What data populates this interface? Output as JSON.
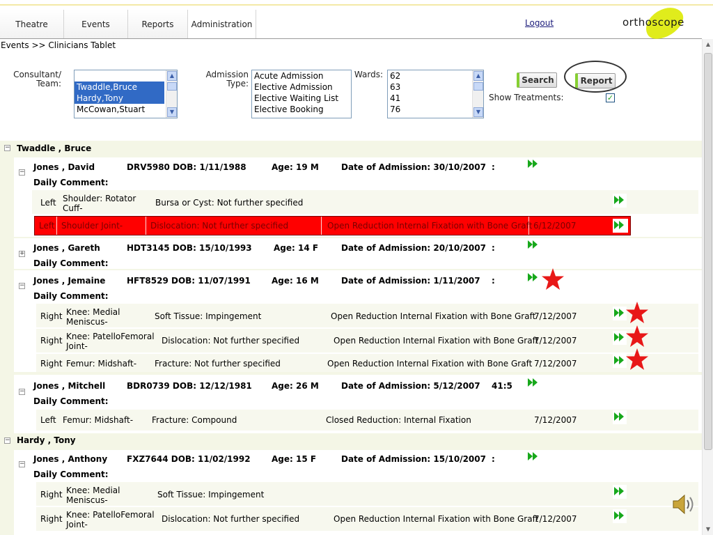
{
  "nav": {
    "tabs": [
      "Theatre",
      "Events",
      "Reports",
      "Administration"
    ],
    "logout": "Logout",
    "logo": "orthoscope"
  },
  "breadcrumb": "Events >> Clinicians Tablet",
  "filters": {
    "consultant_label_1": "Consultant/",
    "consultant_label_2": "Team:",
    "consultant_options": [
      "",
      "Twaddle,Bruce",
      "Hardy,Tony",
      "McCowan,Stuart"
    ],
    "admission_label_1": "Admission",
    "admission_label_2": "Type:",
    "admission_options": [
      "Acute Admission",
      "Elective Admission",
      "Elective Waiting List",
      "Elective Booking"
    ],
    "wards_label": "Wards:",
    "ward_options": [
      "62",
      "63",
      "41",
      "76"
    ],
    "search_button": "Search",
    "report_button": "Report",
    "show_treatments_label": "Show Treatments:",
    "show_treatments_checked": true
  },
  "consultants": [
    {
      "name": "Twaddle , Bruce",
      "patients": [
        {
          "name": "Jones , David",
          "id_dob": "DRV5980 DOB: 1/11/1988",
          "age": "Age: 19 M",
          "admission": "Date of Admission: 30/10/2007",
          "bed": ":",
          "daily_comment": "Daily Comment:",
          "treatments": [
            {
              "side": "Left",
              "site": [
                "Shoulder: Rotator",
                "Cuff-"
              ],
              "diagnosis": "Bursa or Cyst: Not further specified",
              "procedure": "",
              "date": ""
            },
            {
              "side": "Left",
              "site": [
                "Shoulder Joint-"
              ],
              "diagnosis": "Dislocation: Not further specified",
              "procedure": "Open Reduction Internal Fixation with Bone Graft",
              "date": "6/12/2007",
              "highlighted": true
            }
          ]
        },
        {
          "name": "Jones , Gareth",
          "id_dob": "HDT3145 DOB: 15/10/1993",
          "age": "Age: 14 F",
          "admission": "Date of Admission: 20/10/2007",
          "bed": ":",
          "daily_comment": "Daily Comment:",
          "treatments": []
        },
        {
          "name": "Jones , Jemaine",
          "id_dob": "HFT8529 DOB: 11/07/1991",
          "age": "Age: 16 M",
          "admission": "Date of Admission: 1/11/2007",
          "bed": ":",
          "daily_comment": "Daily Comment:",
          "treatments": [
            {
              "side": "Right",
              "site": [
                "Knee: Medial",
                "Meniscus-"
              ],
              "diagnosis": "Soft Tissue: Impingement",
              "procedure": "Open Reduction Internal Fixation with Bone Graft",
              "date": "7/12/2007"
            },
            {
              "side": "Right",
              "site": [
                "Knee: PatelloFemoral",
                "Joint-"
              ],
              "diagnosis": "Dislocation: Not further specified",
              "procedure": "Open Reduction Internal Fixation with Bone Graft",
              "date": "7/12/2007"
            },
            {
              "side": "Right",
              "site": [
                "Femur: Midshaft-"
              ],
              "diagnosis": "Fracture: Not further specified",
              "procedure": "Open Reduction Internal Fixation with Bone Graft",
              "date": "7/12/2007"
            }
          ]
        },
        {
          "name": "Jones , Mitchell",
          "id_dob": "BDR0739 DOB: 12/12/1981",
          "age": "Age: 26 M",
          "admission": "Date of Admission: 5/12/2007",
          "bed": "41:5",
          "daily_comment": "Daily Comment:",
          "treatments": [
            {
              "side": "Left",
              "site": [
                "Femur: Midshaft-"
              ],
              "diagnosis": "Fracture: Compound",
              "procedure": "Closed Reduction: Internal Fixation",
              "date": "7/12/2007"
            }
          ]
        }
      ]
    },
    {
      "name": "Hardy , Tony",
      "patients": [
        {
          "name": "Jones , Anthony",
          "id_dob": "FXZ7644 DOB: 11/02/1992",
          "age": "Age: 15 F",
          "admission": "Date of Admission: 15/10/2007",
          "bed": ":",
          "daily_comment": "Daily Comment:",
          "treatments": [
            {
              "side": "Right",
              "site": [
                "Knee: Medial",
                "Meniscus-"
              ],
              "diagnosis": "Soft Tissue: Impingement",
              "procedure": "",
              "date": ""
            },
            {
              "side": "Right",
              "site": [
                "Knee: PatelloFemoral",
                "Joint-"
              ],
              "diagnosis": "Dislocation: Not further specified",
              "procedure": "Open Reduction Internal Fixation with Bone Graft",
              "date": "7/12/2007"
            }
          ]
        }
      ]
    }
  ],
  "icons": {
    "fast_forward": "fast-forward-icon",
    "star": "star-icon",
    "speaker": "speaker-icon",
    "collapse": "collapse-icon",
    "expand": "expand-icon"
  },
  "colors": {
    "highlight_row": "#ff0000",
    "button_accent": "#86cf32",
    "logo_accent": "#e0ec1c",
    "selection": "#316ac5",
    "indent_bg": "#f5f7e9"
  }
}
